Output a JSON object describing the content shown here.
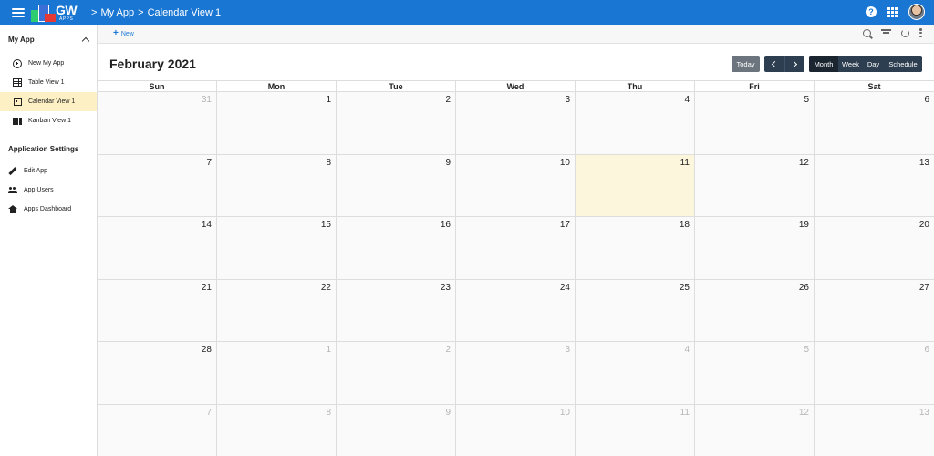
{
  "topbar": {
    "logo_text": "GW",
    "logo_subtext": "APPS",
    "breadcrumbs": [
      "My App",
      "Calendar View 1"
    ]
  },
  "sidebar": {
    "header": "My App",
    "items": [
      {
        "label": "New My App",
        "icon": "add-circle-icon"
      },
      {
        "label": "Table View 1",
        "icon": "table-icon"
      },
      {
        "label": "Calendar View 1",
        "icon": "calendar-icon",
        "active": true
      },
      {
        "label": "Kanban View 1",
        "icon": "kanban-icon"
      }
    ],
    "settings_header": "Application Settings",
    "settings_items": [
      {
        "label": "Edit App",
        "icon": "pencil-icon"
      },
      {
        "label": "App Users",
        "icon": "users-icon"
      },
      {
        "label": "Apps Dashboard",
        "icon": "home-icon"
      }
    ]
  },
  "toolbar": {
    "new_label": "New"
  },
  "calendar": {
    "title": "February 2021",
    "today_label": "Today",
    "views": [
      "Month",
      "Week",
      "Day",
      "Schedule"
    ],
    "active_view": "Month",
    "weekdays": [
      "Sun",
      "Mon",
      "Tue",
      "Wed",
      "Thu",
      "Fri",
      "Sat"
    ],
    "weeks": [
      [
        {
          "d": "31",
          "o": true
        },
        {
          "d": "1"
        },
        {
          "d": "2"
        },
        {
          "d": "3"
        },
        {
          "d": "4"
        },
        {
          "d": "5"
        },
        {
          "d": "6"
        }
      ],
      [
        {
          "d": "7"
        },
        {
          "d": "8"
        },
        {
          "d": "9"
        },
        {
          "d": "10"
        },
        {
          "d": "11",
          "today": true
        },
        {
          "d": "12"
        },
        {
          "d": "13"
        }
      ],
      [
        {
          "d": "14"
        },
        {
          "d": "15"
        },
        {
          "d": "16"
        },
        {
          "d": "17"
        },
        {
          "d": "18"
        },
        {
          "d": "19"
        },
        {
          "d": "20"
        }
      ],
      [
        {
          "d": "21"
        },
        {
          "d": "22"
        },
        {
          "d": "23"
        },
        {
          "d": "24"
        },
        {
          "d": "25"
        },
        {
          "d": "26"
        },
        {
          "d": "27"
        }
      ],
      [
        {
          "d": "28"
        },
        {
          "d": "1",
          "o": true
        },
        {
          "d": "2",
          "o": true
        },
        {
          "d": "3",
          "o": true
        },
        {
          "d": "4",
          "o": true
        },
        {
          "d": "5",
          "o": true
        },
        {
          "d": "6",
          "o": true
        }
      ],
      [
        {
          "d": "7",
          "o": true
        },
        {
          "d": "8",
          "o": true
        },
        {
          "d": "9",
          "o": true
        },
        {
          "d": "10",
          "o": true
        },
        {
          "d": "11",
          "o": true
        },
        {
          "d": "12",
          "o": true
        },
        {
          "d": "13",
          "o": true
        }
      ]
    ]
  },
  "colors": {
    "primary": "#1976d2",
    "today_highlight": "#fcf6dd",
    "active_sidebar": "#fdf0c4",
    "dark_button": "#2c3e50"
  }
}
